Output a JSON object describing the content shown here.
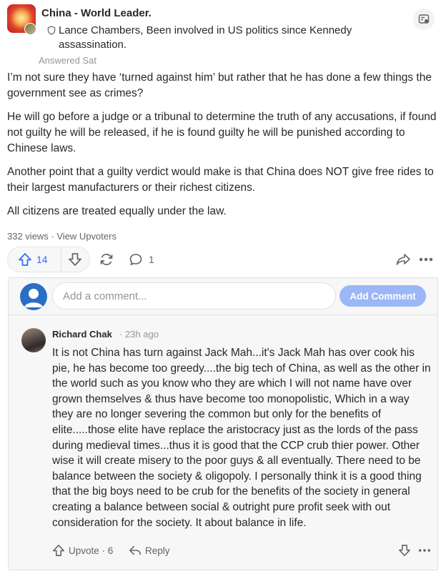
{
  "header": {
    "space_title": "China - World Leader.",
    "author_line": "Lance Chambers, Been involved in US politics since Kennedy assassination.",
    "answered": "Answered Sat",
    "logo_icon": "sun-logo-icon",
    "menu_icon": "follow-space-icon"
  },
  "answer": {
    "paragraphs": [
      "I’m not sure they have ‘turned against him’ but rather that he has done a few things the government see as crimes?",
      "He will go before a judge or a tribunal to determine the truth of any accusations, if found not guilty he will be released, if he is found guilty he will be punished according to Chinese laws.",
      "Another point that a guilty verdict would make is that China does NOT give free rides to their largest manufacturers or their richest citizens.",
      "All citizens are treated equally under the law."
    ]
  },
  "stats": {
    "views": "332 views",
    "separator": " · ",
    "view_upvoters": "View Upvoters"
  },
  "actions": {
    "upvote_count": "14",
    "comment_count": "1"
  },
  "composer": {
    "placeholder": "Add a comment...",
    "button_label": "Add Comment"
  },
  "comment": {
    "author": "Richard Chak",
    "time": "· 23h ago",
    "body": "It is not China has turn against Jack Mah...it's Jack Mah has over cook his pie, he has become too greedy....the big tech of China, as well as the other in the world such as you know who they are which I will not name have over grown themselves & thus have become too monopolistic, Which in a way they are no longer severing the common but only for the benefits of elite.....those elite have replace the aristocracy just as the lords of the pass during medieval times...thus it is good that the CCP crub thier power. Other wise it will create misery to the poor guys & all eventually. There need to be balance between the society & oligopoly. I personally think it is a good thing that the big boys need to be crub for the benefits of the society in general creating a balance between social & outright pure profit seek with out consideration for the society. It about balance in life.",
    "upvote_label": "Upvote · 6",
    "reply_label": "Reply"
  },
  "colors": {
    "accent": "#2e69ff",
    "text": "#282829",
    "muted": "#939598",
    "button_disabled": "#9bb7f7"
  }
}
